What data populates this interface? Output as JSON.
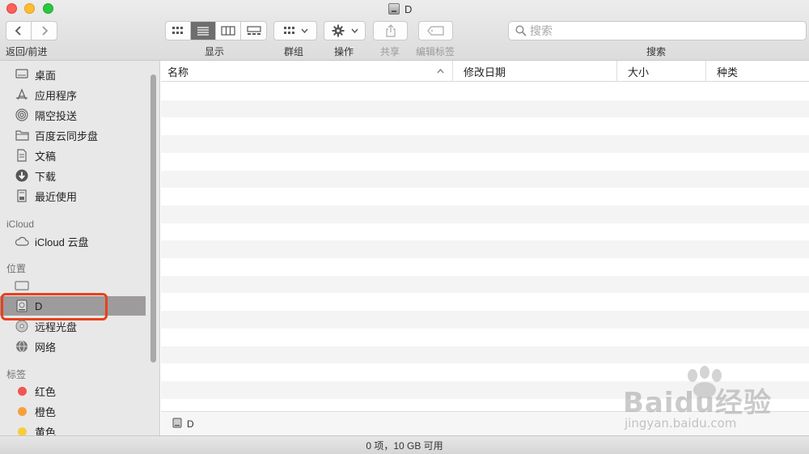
{
  "window": {
    "title": "D"
  },
  "toolbar": {
    "back_forward_label": "返回/前进",
    "view_label": "显示",
    "group_label": "群组",
    "action_label": "操作",
    "share_label": "共享",
    "edit_tags_label": "编辑标签",
    "search_label": "搜索"
  },
  "search": {
    "placeholder": "搜索"
  },
  "sidebar": {
    "favorites": [
      {
        "label": "桌面",
        "icon": "desktop-icon"
      },
      {
        "label": "应用程序",
        "icon": "applications-icon"
      },
      {
        "label": "隔空投送",
        "icon": "airdrop-icon"
      },
      {
        "label": "百度云同步盘",
        "icon": "folder-icon"
      },
      {
        "label": "文稿",
        "icon": "document-icon"
      },
      {
        "label": "下载",
        "icon": "download-icon"
      },
      {
        "label": "最近使用",
        "icon": "recents-icon"
      }
    ],
    "icloud_header": "iCloud",
    "icloud_items": [
      {
        "label": "iCloud 云盘",
        "icon": "cloud-icon"
      }
    ],
    "locations_header": "位置",
    "locations": [
      {
        "label": "",
        "icon": "computer-icon"
      },
      {
        "label": "D",
        "icon": "disk-icon",
        "selected": true
      },
      {
        "label": "远程光盘",
        "icon": "optical-disc-icon"
      },
      {
        "label": "网络",
        "icon": "network-icon"
      }
    ],
    "tags_header": "标签",
    "tags": [
      {
        "label": "红色",
        "color": "#f25553"
      },
      {
        "label": "橙色",
        "color": "#f6a03c"
      },
      {
        "label": "黄色",
        "color": "#f6ce3c"
      }
    ]
  },
  "columns": {
    "name": "名称",
    "modified": "修改日期",
    "size": "大小",
    "kind": "种类"
  },
  "path_bar": {
    "label": "D"
  },
  "status": {
    "text": "0 项，10 GB 可用"
  },
  "watermark": {
    "logo": "Baidu经验",
    "url": "jingyan.baidu.com"
  },
  "colors": {
    "highlight": "#e8401c",
    "selection": "#9d9b9b"
  }
}
